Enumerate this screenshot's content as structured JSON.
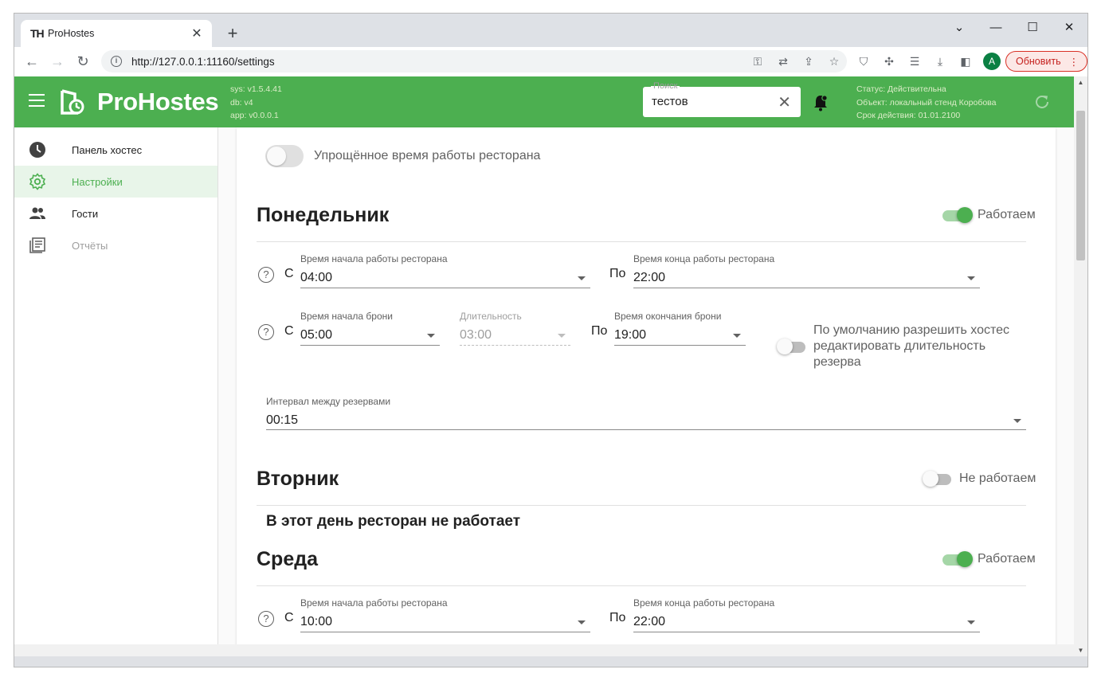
{
  "browser": {
    "tab_title": "ProHostes",
    "tab_logo": "TH",
    "url": "http://127.0.0.1:11160/settings",
    "update_label": "Обновить",
    "avatar_letter": "A"
  },
  "appbar": {
    "brand": "ProHostes",
    "versions": [
      "sys: v1.5.4.41",
      "db: v4",
      "app: v0.0.0.1"
    ],
    "search_label": "Поиск",
    "search_value": "тестов",
    "status": [
      "Статус: Действительна",
      "Объект: локальный стенд Коробова",
      "Срок действия: 01.01.2100"
    ],
    "color": "#4caf50"
  },
  "sidebar": {
    "items": [
      {
        "label": "Панель хостес",
        "icon": "clock-icon"
      },
      {
        "label": "Настройки",
        "icon": "gear-icon"
      },
      {
        "label": "Гости",
        "icon": "people-icon"
      },
      {
        "label": "Отчёты",
        "icon": "report-icon"
      }
    ]
  },
  "settings": {
    "simplified_label": "Упрощённое время работы ресторана",
    "monday": {
      "title": "Понедельник",
      "status": "Работаем",
      "from_prefix": "С",
      "to_prefix": "По",
      "open_label": "Время начала работы ресторана",
      "open_value": "04:00",
      "close_label": "Время конца работы ресторана",
      "close_value": "22:00",
      "booking_start_label": "Время начала брони",
      "booking_start_value": "05:00",
      "duration_label": "Длительность",
      "duration_value": "03:00",
      "booking_end_label": "Время окончания брони",
      "booking_end_value": "19:00",
      "allow_edit_label": "По умолчанию разрешить хостес редактировать длительность резерва",
      "interval_label": "Интервал между резервами",
      "interval_value": "00:15"
    },
    "tuesday": {
      "title": "Вторник",
      "status": "Не работаем",
      "closed_message": "В этот день ресторан не работает"
    },
    "wednesday": {
      "title": "Среда",
      "status": "Работаем",
      "from_prefix": "С",
      "to_prefix": "По",
      "open_label": "Время начала работы ресторана",
      "open_value": "10:00",
      "close_label": "Время конца работы ресторана",
      "close_value": "22:00"
    }
  }
}
